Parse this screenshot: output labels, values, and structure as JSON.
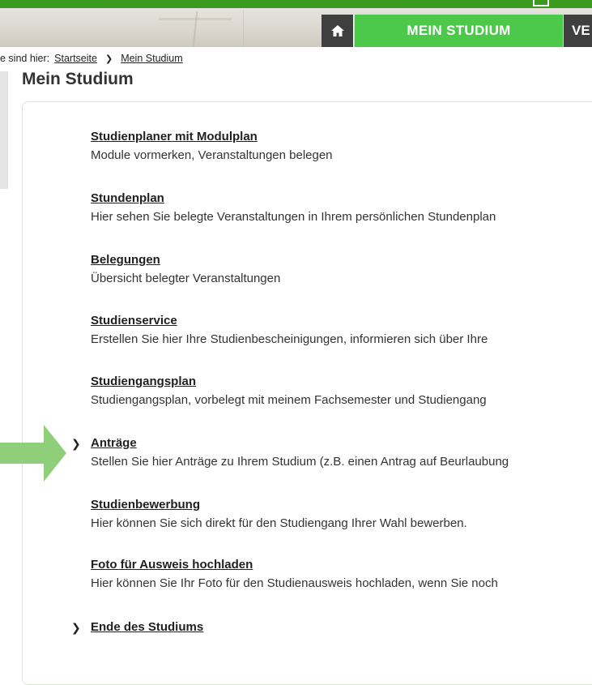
{
  "header": {
    "home_icon": "home-icon",
    "nav_active_label": "MEIN STUDIUM",
    "nav_next_label": "VE",
    "colors": {
      "green": "#4cc94a",
      "dark": "#3f3f3f",
      "topline": "#3a9a1d"
    }
  },
  "breadcrumb": {
    "prefix": "e sind hier:",
    "items": [
      "Startseite",
      "Mein Studium"
    ],
    "separator_icon": "chevron-right-icon"
  },
  "page": {
    "title": "Mein Studium"
  },
  "menu": {
    "items": [
      {
        "title": "Studienplaner mit Modulplan",
        "desc": "Module vormerken, Veranstaltungen belegen",
        "expandable": false
      },
      {
        "title": "Stundenplan",
        "desc": "Hier sehen Sie belegte Veranstaltungen in Ihrem persönlichen Stundenplan",
        "expandable": false
      },
      {
        "title": "Belegungen",
        "desc": "Übersicht belegter Veranstaltungen",
        "expandable": false
      },
      {
        "title": "Studienservice",
        "desc": "Erstellen Sie hier Ihre Studienbescheinigungen, informieren sich über Ihre",
        "expandable": false
      },
      {
        "title": "Studiengangsplan",
        "desc": "Studiengangsplan, vorbelegt mit meinem Fachsemester und Studiengang",
        "expandable": false
      },
      {
        "title": "Anträge",
        "desc": "Stellen Sie hier Anträge zu Ihrem Studium (z.B. einen Antrag auf Beurlaubung",
        "expandable": true
      },
      {
        "title": "Studienbewerbung",
        "desc": "Hier können Sie sich direkt für den Studiengang Ihrer Wahl bewerben.",
        "expandable": false
      },
      {
        "title": "Foto für Ausweis hochladen",
        "desc": "Hier können Sie Ihr Foto für den Studienausweis hochladen, wenn Sie noch",
        "expandable": false
      },
      {
        "title": "Ende des Studiums",
        "desc": "",
        "expandable": true
      }
    ],
    "chevron_icon": "chevron-right-icon"
  },
  "annotation": {
    "arrow_icon": "green-arrow-icon",
    "color": "#8fcf79"
  }
}
